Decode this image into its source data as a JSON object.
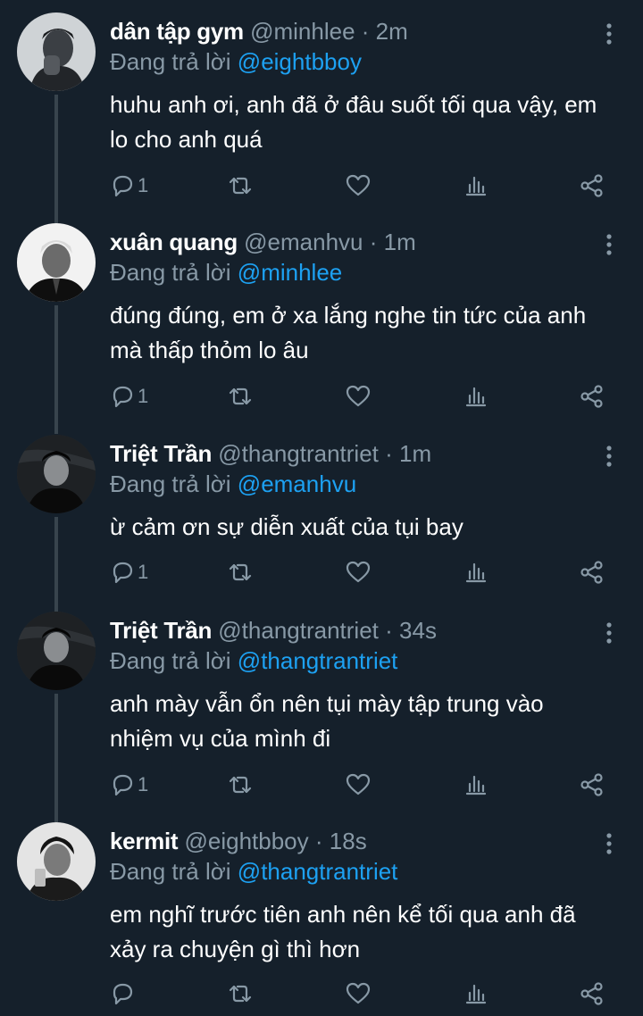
{
  "reply_prefix": "Đang trả lời",
  "colors": {
    "background": "#15202b",
    "muted": "#8899a6",
    "link": "#1da1f2",
    "text": "#ffffff"
  },
  "tweets": [
    {
      "name": "dân tập gym",
      "handle": "@minhlee",
      "time": "2m",
      "reply_to": "@eightbboy",
      "text": "huhu anh ơi, anh đã ở đâu suốt tối qua vậy, em lo cho anh quá",
      "reply_count": "1",
      "avatar": "avatar-man-hand-on-face"
    },
    {
      "name": "xuân quang",
      "handle": "@emanhvu",
      "time": "1m",
      "reply_to": "@minhlee",
      "text": "đúng đúng, em ở xa lắng nghe tin tức của anh mà thấp thỏm lo âu",
      "reply_count": "1",
      "avatar": "avatar-man-bleached-hair"
    },
    {
      "name": "Triệt Trần",
      "handle": "@thangtrantriet",
      "time": "1m",
      "reply_to": "@emanhvu",
      "text": "ừ cảm ơn sự diễn xuất của tụi bay",
      "reply_count": "1",
      "avatar": "avatar-man-dark"
    },
    {
      "name": "Triệt Trần",
      "handle": "@thangtrantriet",
      "time": "34s",
      "reply_to": "@thangtrantriet",
      "text": "anh mày vẫn ổn nên tụi mày tập trung vào nhiệm vụ của mình đi",
      "reply_count": "1",
      "avatar": "avatar-man-dark"
    },
    {
      "name": "kermit",
      "handle": "@eightbboy",
      "time": "18s",
      "reply_to": "@thangtrantriet",
      "text": "em nghĩ trước tiên anh nên kể tối qua anh đã xảy ra chuyện gì thì hơn",
      "reply_count": "",
      "avatar": "avatar-man-holding-glass"
    }
  ],
  "icons": [
    "reply-icon",
    "retweet-icon",
    "like-icon",
    "analytics-icon",
    "share-icon",
    "more-icon"
  ]
}
